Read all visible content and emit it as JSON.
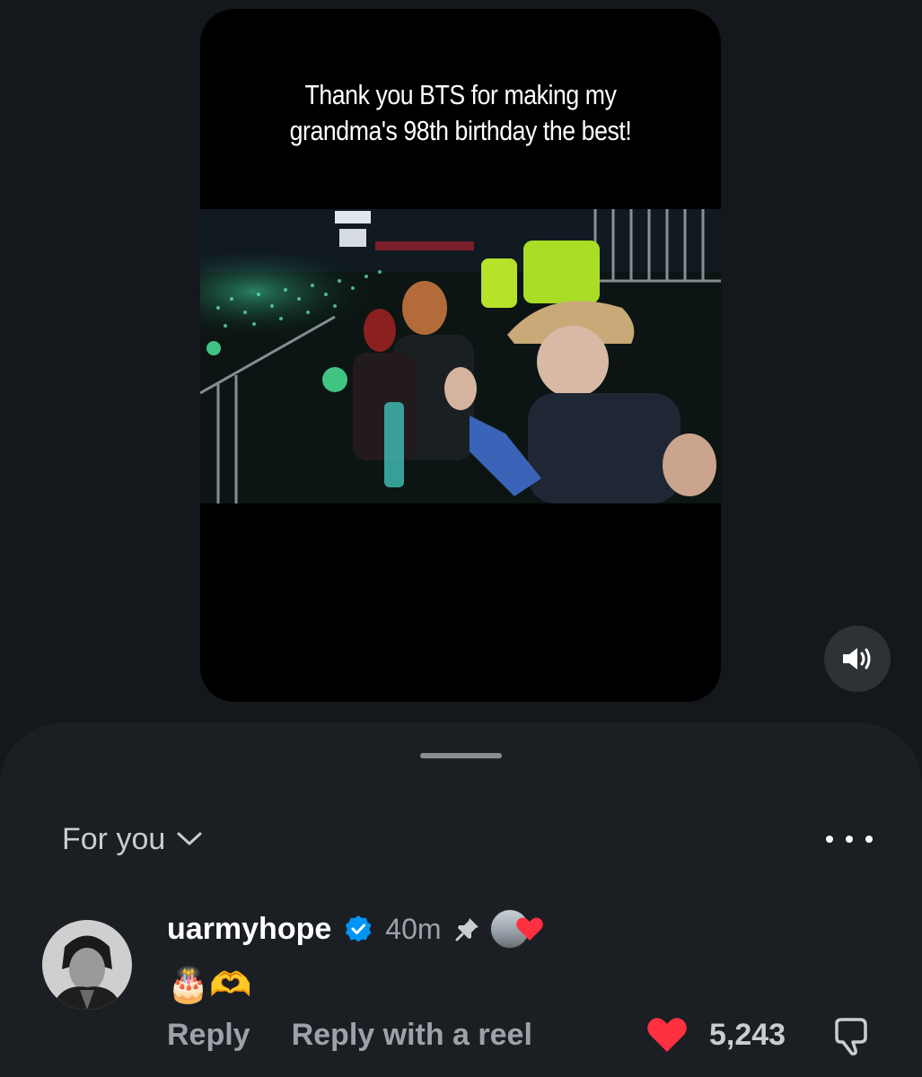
{
  "reel": {
    "caption": "Thank you BTS for making my\ngrandma's 98th birthday the best!"
  },
  "controls": {
    "sound_icon": "speaker-volume-icon"
  },
  "comments": {
    "filter_label": "For you",
    "filter_icon": "chevron-down-icon",
    "more_icon": "more-horizontal-icon",
    "items": [
      {
        "username": "uarmyhope",
        "verified": true,
        "time": "40m",
        "pinned": true,
        "creator_liked": true,
        "text": "🎂🫶",
        "reply_label": "Reply",
        "reply_reel_label": "Reply with a reel",
        "likes": "5,243",
        "liked": true
      }
    ]
  },
  "colors": {
    "background": "#14171c",
    "sheet": "#1b1e23",
    "heart": "#ff3040",
    "verified": "#0095f6",
    "secondary_text": "#9ea2a8"
  }
}
